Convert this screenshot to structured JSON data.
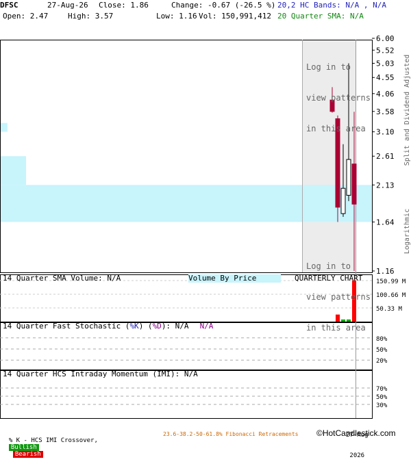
{
  "header": {
    "ticker": "DFSC",
    "date": "27-Aug-26",
    "close_text": "Close: 1.86",
    "change_text": "Change: -0.67 (-26.5 %)",
    "open_text": "Open: 2.47",
    "high_text": "High: 3.57",
    "low_text": "Low: 1.16",
    "vol_text": "Vol: 150,991,412",
    "bands_text": "20,2 HC Bands: N/A , N/A",
    "sma_text": "20 Quarter SMA: N/A"
  },
  "price_panel": {
    "side_label_top": "Split and Dividend Adjusted",
    "side_label_bottom": "Logarithmic",
    "login_text": [
      "Log in to",
      "view patterns",
      "in this area"
    ],
    "colors": {
      "up": "#ffffff",
      "down": "#aa0033",
      "vbp": "#c8f4fc",
      "shade": "#ececec"
    }
  },
  "volume_panel": {
    "sma_label": "14 Quarter SMA Volume: N/A",
    "vbp_label": "Volume By Price",
    "chart_label": "QUARTERLY CHART",
    "ticks": [
      "150.99 M",
      "100.66 M",
      "50.33 M"
    ]
  },
  "stoch_panel": {
    "label_prefix": "14 Quarter Fast Stochastic (",
    "k_label": "%K",
    "mid": ") (",
    "d_label": "%D",
    "suffix": "): N/A",
    "na2": "N/A",
    "ticks": [
      "80%",
      "50%",
      "20%"
    ]
  },
  "imi_panel": {
    "label": "14 Quarter HCS Intraday Momentum (IMI): N/A",
    "ticks": [
      "70%",
      "50%",
      "30%"
    ]
  },
  "x_axis": {
    "label_line1": "27-Aug",
    "label_line2": "2026"
  },
  "footer": {
    "legend_prefix": "% K - HCS IMI Crossover,",
    "bullish": "Bullish",
    "bearish": "Bearish",
    "fib": "23.6-38.2-50-61.8% Fibonacci Retracements",
    "brand": "©HotCandlestick.com"
  },
  "chart_data": {
    "type": "candlestick",
    "yscale": "log",
    "ylim": [
      1.16,
      6.0
    ],
    "yticks": [
      6.0,
      5.52,
      5.03,
      4.55,
      4.06,
      3.58,
      3.1,
      2.61,
      2.13,
      1.64,
      1.16
    ],
    "ytick_labels": [
      "6.00",
      "5.52",
      "5.03",
      "4.55",
      "4.06",
      "3.58",
      "3.10",
      "2.61",
      "2.13",
      "1.64",
      "1.16"
    ],
    "candles": [
      {
        "open": 3.88,
        "high": 4.25,
        "low": 3.55,
        "close": 3.58
      },
      {
        "open": 3.4,
        "high": 3.48,
        "low": 1.64,
        "close": 1.82
      },
      {
        "open": 1.74,
        "high": 2.84,
        "low": 1.7,
        "close": 2.08
      },
      {
        "open": 1.98,
        "high": 5.03,
        "low": 1.9,
        "close": 2.55
      },
      {
        "open": 2.47,
        "high": 3.57,
        "low": 1.16,
        "close": 1.86
      }
    ],
    "volume_by_price": [
      {
        "low": 3.1,
        "high": 3.3,
        "rel": 0.02
      },
      {
        "low": 2.13,
        "high": 2.61,
        "rel": 0.07
      },
      {
        "low": 1.64,
        "high": 2.13,
        "rel": 1.0
      }
    ],
    "volume_ylim": [
      0,
      150.99
    ],
    "volume_unit": "M",
    "volumes": [
      0,
      26,
      8,
      8,
      150.99
    ]
  }
}
